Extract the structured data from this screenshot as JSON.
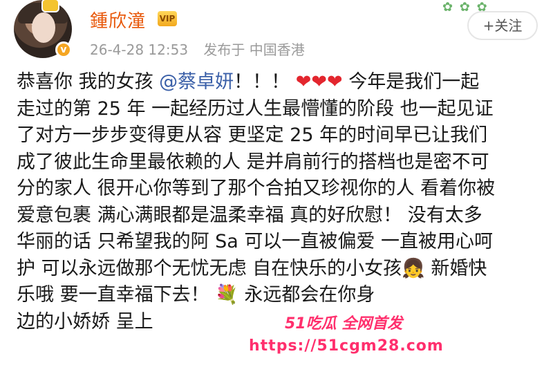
{
  "profile": {
    "username": "鍾欣潼",
    "vip_badge": "VIP",
    "verified_mark": "v",
    "timestamp": "26-4-28 12:53",
    "posted_from": "发布于 中国香港",
    "follow_label": "+关注",
    "accent": "#e8590c"
  },
  "post": {
    "line1_pre": "恭喜你 我的女孩 ",
    "mention": "@蔡卓妍",
    "line1_post": "！！！",
    "hearts": "❤❤❤",
    "line1_tail": " 今年是我们一起",
    "line2": "走过的第 25 年  一起经历过人生最懵懂的阶段  也一起见证",
    "line3": "了对方一步步变得更从容  更坚定   25 年的时间早已让我们",
    "line4": "成了彼此生命里最依赖的人  是并肩前行的搭档也是密不可",
    "line5": "分的家人   很开心你等到了那个合拍又珍视你的人  看着你被",
    "line6": "爱意包裹  满心满眼都是温柔幸福  真的好欣慰！  没有太多",
    "line7": "华丽的话  只希望我的阿 Sa 可以一直被偏爱  一直被用心呵",
    "line8": "护  可以永远做那个无忧无虑  自在快乐的小女孩👧  新婚快",
    "line9": "乐哦  要一直幸福下去！ 💐  永远都会在你身",
    "line10": "边的小娇娇  呈上"
  },
  "watermark": {
    "brand": "51吃瓜 全网首发",
    "url": "https://51cgm28.com"
  }
}
